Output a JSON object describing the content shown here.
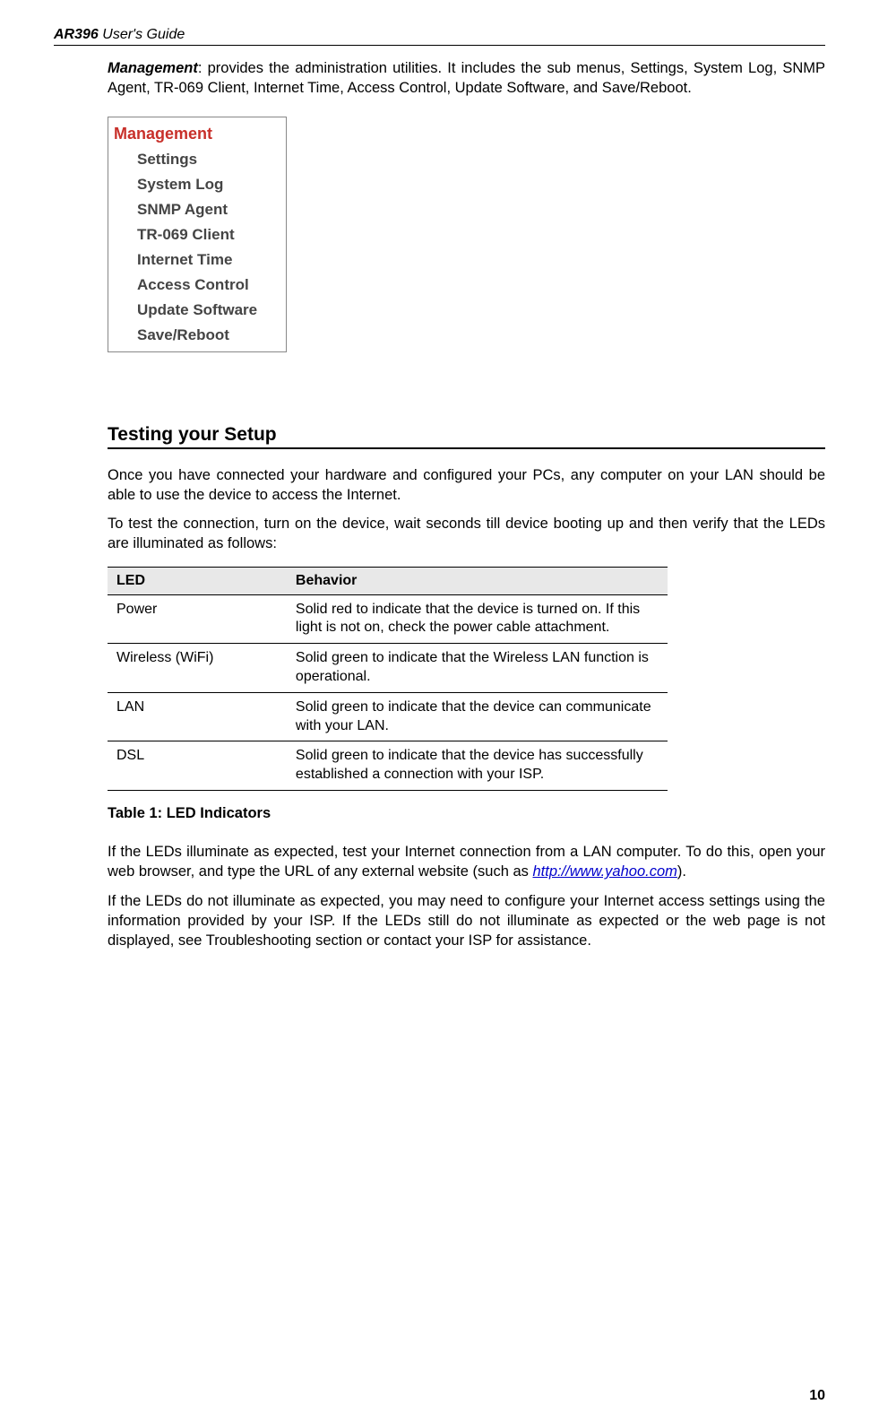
{
  "header": {
    "product": "AR396",
    "subtitle": "User's Guide"
  },
  "intro": {
    "em_word": "Management",
    "text": ": provides the administration utilities. It includes the sub menus, Settings, System Log, SNMP Agent, TR-069 Client, Internet Time, Access Control, Update Software, and Save/Reboot."
  },
  "menu": {
    "title": "Management",
    "items": [
      "Settings",
      "System Log",
      "SNMP Agent",
      "TR-069 Client",
      "Internet Time",
      "Access Control",
      "Update Software",
      "Save/Reboot"
    ]
  },
  "section_title": "Testing your Setup",
  "para1": "Once you have connected your hardware and configured your PCs, any computer on your LAN should be able to use the device to access the Internet.",
  "para2": "To test the connection, turn on the device, wait seconds till device booting up and then verify that the LEDs are illuminated as follows:",
  "table": {
    "header": {
      "col1": "LED",
      "col2": "Behavior"
    },
    "rows": [
      {
        "led": "Power",
        "behavior": "Solid red to indicate that the device is turned on. If this light is not on, check the power cable attachment."
      },
      {
        "led": "Wireless (WiFi)",
        "behavior": "Solid green to indicate that the Wireless LAN function is operational."
      },
      {
        "led": "LAN",
        "behavior": "Solid green to indicate that the device can communicate with your LAN."
      },
      {
        "led": "DSL",
        "behavior": "Solid green to indicate that the device has successfully established a connection with your ISP."
      }
    ]
  },
  "table_caption": "Table 1: LED Indicators",
  "para3_pre": "If the LEDs illuminate as expected, test your Internet connection from a LAN computer. To do this, open your web browser, and type the URL of any external website (such as ",
  "para3_link": "http://www.yahoo.com",
  "para3_post": ").",
  "para4": "If the LEDs do not illuminate as expected, you may need to configure your Internet access settings using the information provided by your ISP. If the LEDs still do not illuminate as expected or the web page is not displayed, see Troubleshooting section or contact your ISP for assistance.",
  "page_number": "10"
}
